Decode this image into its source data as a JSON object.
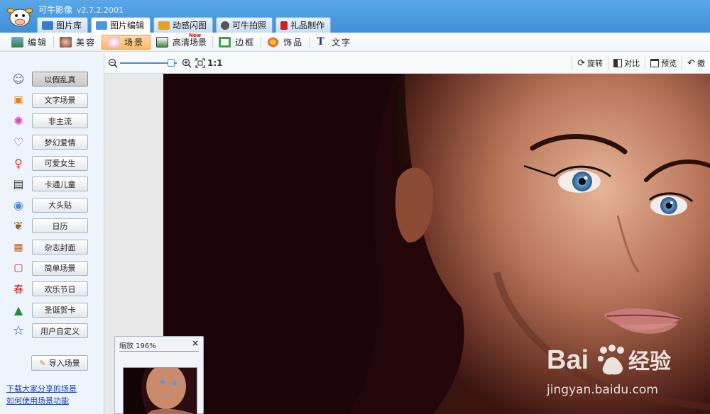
{
  "app": {
    "title": "可牛影像",
    "version": "v2.7.2.2001"
  },
  "main_tabs": [
    {
      "label": "图片库",
      "color": "#3a7cc8"
    },
    {
      "label": "图片编辑",
      "color": "#4a9ad8"
    },
    {
      "label": "动感闪图",
      "color": "#e8a020"
    },
    {
      "label": "可牛拍照",
      "color": "#555555"
    },
    {
      "label": "礼品制作",
      "color": "#d02020"
    }
  ],
  "edit_tools": [
    {
      "label": "编辑"
    },
    {
      "label": "美容"
    },
    {
      "label": "场景"
    },
    {
      "label": "高清场景",
      "badge": "New"
    },
    {
      "label": "边框"
    },
    {
      "label": "饰品"
    },
    {
      "label": "文字"
    }
  ],
  "scenes": [
    {
      "label": "以假乱真",
      "icon": "avatar-face-icon"
    },
    {
      "label": "文字场景",
      "icon": "text-frame-icon"
    },
    {
      "label": "非主流",
      "icon": "sparkle-icon"
    },
    {
      "label": "梦幻爱情",
      "icon": "heart-icon"
    },
    {
      "label": "可爱女生",
      "icon": "female-icon"
    },
    {
      "label": "卡通儿童",
      "icon": "book-icon"
    },
    {
      "label": "大头贴",
      "icon": "girl-portrait-icon"
    },
    {
      "label": "日历",
      "icon": "dog-icon"
    },
    {
      "label": "杂志封面",
      "icon": "calendar-icon"
    },
    {
      "label": "简单场景",
      "icon": "frame-icon"
    },
    {
      "label": "欢乐节日",
      "icon": "spring-festival-icon"
    },
    {
      "label": "圣诞贺卡",
      "icon": "christmas-tree-icon"
    },
    {
      "label": "用户自定义",
      "icon": "star-icon"
    }
  ],
  "sidebar": {
    "import_label": "导入场景",
    "link_download": "下载大家分享的场景",
    "link_howto": "如何使用场景功能"
  },
  "zoom": {
    "one_to_one": "1:1",
    "level": 0.9
  },
  "right_tools": [
    {
      "label": "旋转",
      "icon": "rotate-icon"
    },
    {
      "label": "对比",
      "icon": "compare-icon"
    },
    {
      "label": "预览",
      "icon": "preview-icon"
    },
    {
      "label": "撤",
      "icon": "undo-icon"
    }
  ],
  "zoom_panel": {
    "title": "缩放 196%",
    "close": "×"
  },
  "watermark": {
    "brand": "Bai",
    "brand2": "经验",
    "url": "jingyan.baidu.com"
  },
  "colors": {
    "accent": "#3d8fd8",
    "active_tool": "#ffb861",
    "link": "#1a3fb0"
  }
}
